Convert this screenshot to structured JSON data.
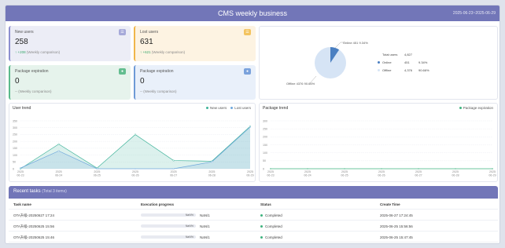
{
  "header": {
    "title": "CMS weekly business",
    "date_range": "2025-06-23~2025-06-29"
  },
  "cards": {
    "new_users": {
      "label": "New users",
      "value": "258",
      "change": "+208",
      "compare": "(Weekly comparison)"
    },
    "lost_users": {
      "label": "Lost users",
      "value": "631",
      "change": "+621",
      "compare": "(Weekly comparison)"
    },
    "package_expiration_1": {
      "label": "Package expiration",
      "value": "0",
      "change": "--",
      "compare": "(Weekly comparison)"
    },
    "package_expiration_2": {
      "label": "Package expiration",
      "value": "0",
      "change": "--",
      "compare": "(Weekly comparison)"
    }
  },
  "pie": {
    "online_label": "Online  451  9.34%",
    "offline_label": "Offline  4376  90.66%",
    "total_key": "Total users",
    "total_val": "4,827",
    "online_key": "Online",
    "online_val": "451",
    "online_pct": "9.34%",
    "offline_key": "Offline",
    "offline_val": "4,376",
    "offline_pct": "90.66%",
    "colors": {
      "online": "#4a7fc1",
      "offline": "#d6e4f5"
    }
  },
  "user_trend": {
    "title": "User trend",
    "legend_new": "New users",
    "legend_lost": "Lost users"
  },
  "package_trend": {
    "title": "Package trend",
    "legend": "Package expiration"
  },
  "chart_data": [
    {
      "type": "area",
      "title": "User trend",
      "categories": [
        "2025 06-23",
        "2025 06-24",
        "2025 06-25",
        "2025 06-26",
        "2025 06-27",
        "2025 06-28",
        "2025 06-29"
      ],
      "series": [
        {
          "name": "New users",
          "values": [
            0,
            180,
            5,
            250,
            60,
            55,
            310
          ],
          "color": "#3fb39a"
        },
        {
          "name": "Lost users",
          "values": [
            5,
            130,
            0,
            0,
            0,
            50,
            305
          ],
          "color": "#6fa8dc"
        }
      ],
      "yticks": [
        0,
        50,
        100,
        150,
        200,
        250,
        300,
        350
      ],
      "ylim": [
        0,
        350
      ]
    },
    {
      "type": "line",
      "title": "Package trend",
      "categories": [
        "2025 06-23",
        "2025 06-24",
        "2025 06-25",
        "2025 06-26",
        "2025 06-27",
        "2025 06-28",
        "2025 06-29"
      ],
      "series": [
        {
          "name": "Package expiration",
          "values": [
            0,
            0,
            0,
            0,
            0,
            0,
            0
          ],
          "color": "#3fb37f"
        }
      ],
      "yticks": [
        0,
        50,
        100,
        150,
        200,
        250,
        300
      ],
      "ylim": [
        0,
        300
      ]
    }
  ],
  "tasks": {
    "title": "Recent tasks",
    "total": "(Total 3 items)",
    "headers": {
      "name": "Task name",
      "progress": "Execution progress",
      "status": "Status",
      "time": "Create Time"
    },
    "rows": [
      {
        "name": "OTA升级-20250627 17:24",
        "pct": "NaN%",
        "frac": "NaN/1",
        "status": "Completed",
        "time": "2025-06-27 17:24:45"
      },
      {
        "name": "OTA升级-20250625 15:56",
        "pct": "NaN%",
        "frac": "NaN/1",
        "status": "Completed",
        "time": "2025-06-25 15:56:56"
      },
      {
        "name": "OTA升级-20250625 15:46",
        "pct": "NaN%",
        "frac": "NaN/1",
        "status": "Completed",
        "time": "2025-06-25 15:47:45"
      }
    ]
  }
}
